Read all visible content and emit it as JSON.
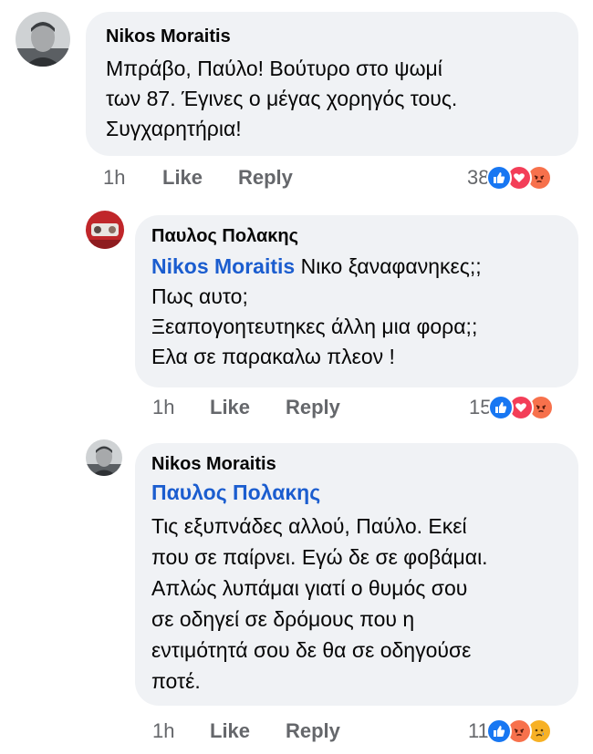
{
  "comments": [
    {
      "author": "Nikos Moraitis",
      "mention": "",
      "lines": [
        "Μπράβο, Παύλο! Βούτυρο στο ψωμί",
        "των 87. Έγινες ο μέγας χορηγός τους.",
        "Συγχαρητήρια!"
      ],
      "time": "1h",
      "like_label": "Like",
      "reply_label": "Reply",
      "reaction_count": "38",
      "reactions": [
        "like",
        "love",
        "angry"
      ]
    },
    {
      "author": "Παυλος Πολακης",
      "mention": "Nikos Moraitis",
      "lines": [
        " Νικο ξαναφανηκες;;",
        "Πως αυτο;",
        "Ξεαπογοητευτηκες άλλη μια φορα;;",
        "Ελα σε παρακαλω πλεον !"
      ],
      "time": "1h",
      "like_label": "Like",
      "reply_label": "Reply",
      "reaction_count": "15",
      "reactions": [
        "like",
        "love",
        "angry"
      ]
    },
    {
      "author": "Nikos Moraitis",
      "mention": "Παυλος Πολακης",
      "lines": [
        "Τις εξυπνάδες αλλού, Παύλο. Εκεί",
        "που σε παίρνει. Εγώ δε σε φοβάμαι.",
        "Απλώς λυπάμαι γιατί ο θυμός σου",
        "σε οδηγεί σε δρόμους που η",
        "εντιμότητά σου δε θα σε οδηγούσε",
        "ποτέ."
      ],
      "time": "1h",
      "like_label": "Like",
      "reply_label": "Reply",
      "reaction_count": "11",
      "reactions": [
        "like",
        "angry",
        "sad"
      ]
    }
  ],
  "colors": {
    "bubble": "#f0f2f5",
    "mention": "#1b5dcf",
    "meta": "#65676b",
    "like": "#1877f2",
    "love": "#f33e58",
    "angry": "#f7714c",
    "sad": "#f7b125"
  }
}
